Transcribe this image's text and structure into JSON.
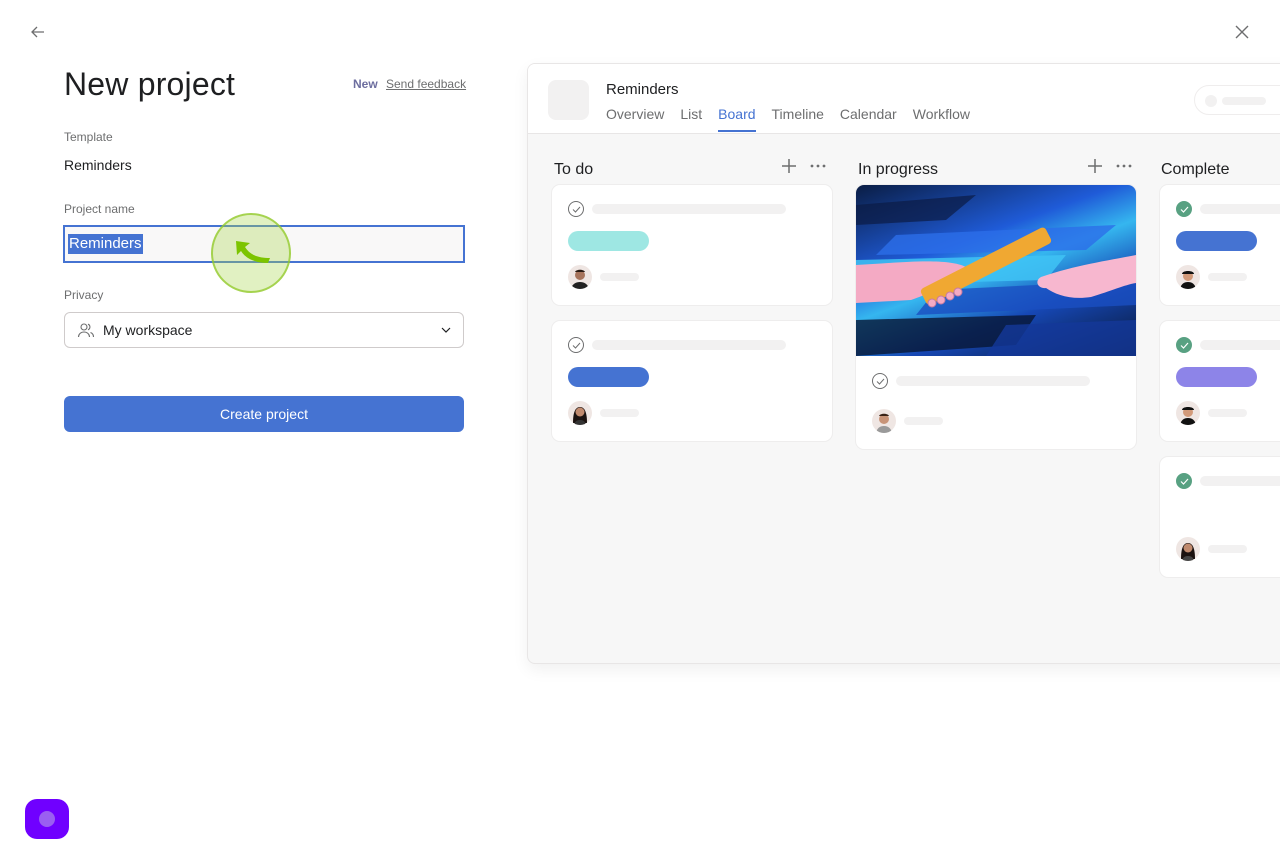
{
  "nav": {
    "back_icon": "arrow-left-icon",
    "close_icon": "close-x-icon"
  },
  "form": {
    "title": "New project",
    "new_badge": "New",
    "feedback_link": "Send feedback",
    "template_label": "Template",
    "template_value": "Reminders",
    "project_name_label": "Project name",
    "project_name_value": "Reminders",
    "privacy_label": "Privacy",
    "privacy_value": "My workspace",
    "privacy_icon": "people-icon",
    "create_button": "Create project"
  },
  "preview": {
    "project_name": "Reminders",
    "tabs": [
      {
        "label": "Overview",
        "active": false
      },
      {
        "label": "List",
        "active": false
      },
      {
        "label": "Board",
        "active": true
      },
      {
        "label": "Timeline",
        "active": false
      },
      {
        "label": "Calendar",
        "active": false
      },
      {
        "label": "Workflow",
        "active": false
      }
    ],
    "columns": [
      {
        "title": "To do",
        "cards": [
          {
            "completed": false,
            "tag_color": "#9ee7e3",
            "has_cover": false
          },
          {
            "completed": false,
            "tag_color": "#4573d2",
            "has_cover": false
          }
        ]
      },
      {
        "title": "In progress",
        "cards": [
          {
            "completed": false,
            "tag_color": null,
            "has_cover": true
          }
        ]
      },
      {
        "title": "Complete",
        "cards": [
          {
            "completed": true,
            "tag_color": "#4573d2",
            "has_cover": false
          },
          {
            "completed": true,
            "tag_color": "#8d84e8",
            "has_cover": false
          },
          {
            "completed": true,
            "tag_color": null,
            "has_cover": false
          }
        ]
      }
    ]
  },
  "colors": {
    "accent": "#4573d2",
    "complete_green": "#58a182",
    "help_purple": "#7000ff"
  }
}
